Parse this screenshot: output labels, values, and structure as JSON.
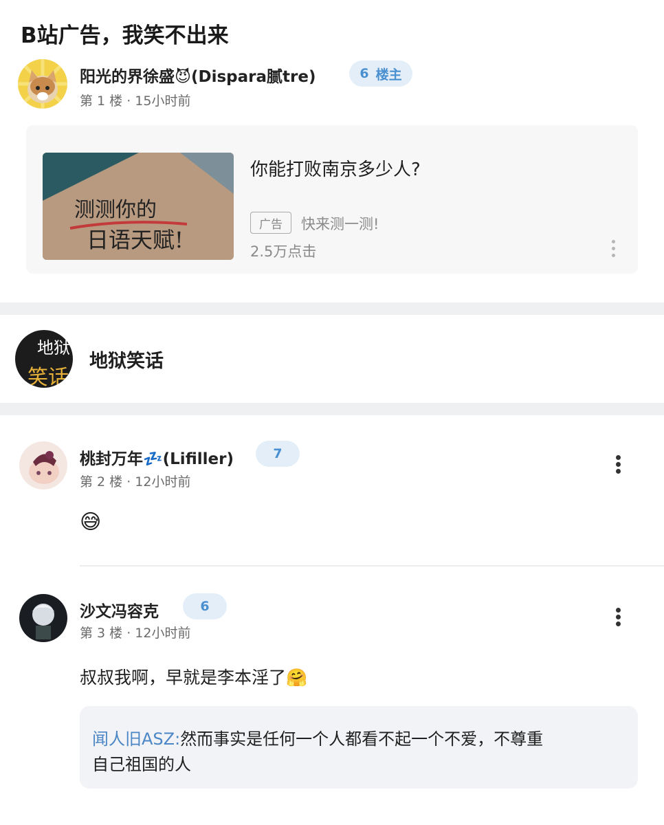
{
  "post": {
    "title": "B站广告，我笑不出来"
  },
  "op": {
    "username": "阳光的界徐盛😈(Dispara腻tre)",
    "level": "6",
    "role": "楼主",
    "floor_meta": "第 1 楼 · 15小时前"
  },
  "ad": {
    "image_text_line1": "测测你的",
    "image_text_line2": "日语天赋!",
    "title": "你能打败南京多少人?",
    "tag": "广告",
    "subtitle": "快来测一测!",
    "clicks": "2.5万点击"
  },
  "topic": {
    "avatar_text_line1": "地狱",
    "avatar_text_line2": "笑话",
    "name": "地狱笑话"
  },
  "comments": [
    {
      "username": "桃封万年💤(Lifiller)",
      "level": "7",
      "floor_meta": "第 2 楼 · 12小时前",
      "text": "😅"
    },
    {
      "username": "沙文冯容克",
      "level": "6",
      "floor_meta": "第 3 楼 · 12小时前",
      "text": "叔叔我啊，早就是李本淫了🤗",
      "reply": {
        "user": "闻人旧ASZ:",
        "text_line1": "然而事实是任何一个人都看不起一个不爱，不尊重",
        "text_line2": "自己祖国的人"
      }
    }
  ],
  "colors": {
    "badge_bg": "#e3eef9",
    "badge_text": "#4a8fd0",
    "reply_user": "#4b86c6"
  }
}
